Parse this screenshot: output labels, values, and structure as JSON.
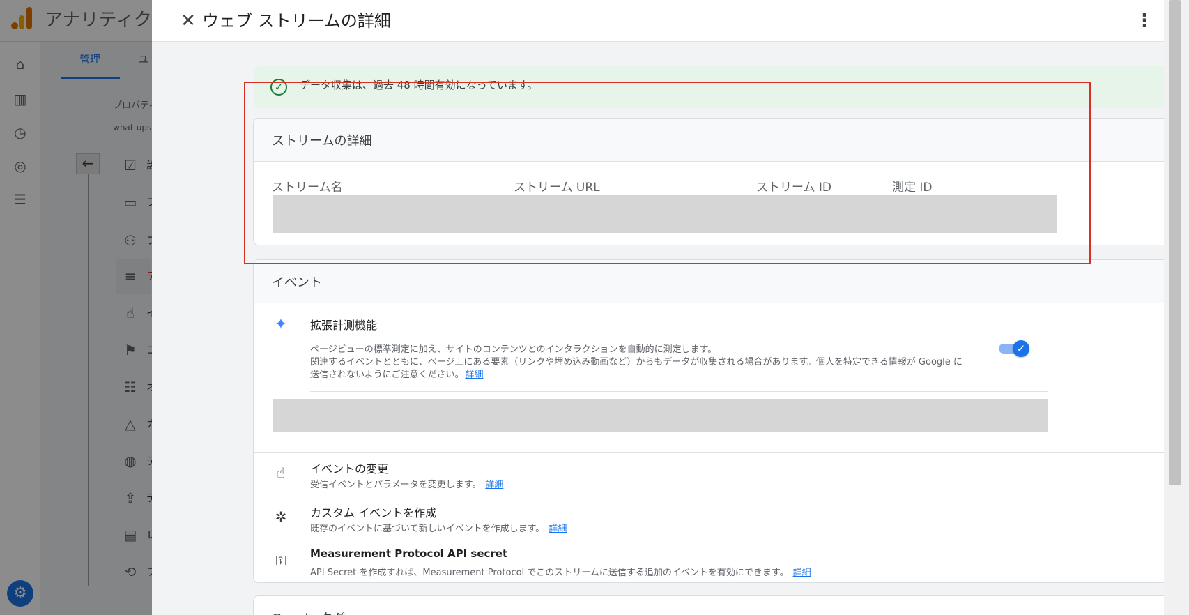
{
  "background_app": {
    "app_title": "アナリティクス",
    "tabs": {
      "manage": "管理",
      "user": "ユ"
    },
    "property_label": "プロパティ",
    "property_value": "what-ups-",
    "nav_letters": [
      "設",
      "フ",
      "フ",
      "デ",
      "イ",
      "コ",
      "オ",
      "カ",
      "デ",
      "デ",
      "レ",
      "フ"
    ]
  },
  "panel": {
    "title": "ウェブ ストリームの詳細",
    "banner_text": "データ収集は、過去 48 時間有効になっています。",
    "stream_details": {
      "heading": "ストリームの詳細",
      "columns": [
        "ストリーム名",
        "ストリーム URL",
        "ストリーム ID",
        "測定 ID"
      ]
    },
    "events": {
      "heading": "イベント",
      "enhanced": {
        "title": "拡張計測機能",
        "desc_line1": "ページビューの標準測定に加え、サイトのコンテンツとのインタラクションを自動的に測定します。",
        "desc_line2": "関連するイベントとともに、ページ上にある要素（リンクや埋め込み動画など）からもデータが収集される場合があります。個人を特定できる情報が Google に",
        "desc_line3": "送信されないようにご注意ください。",
        "link": "詳細",
        "enabled": true
      },
      "rows": [
        {
          "title": "イベントの変更",
          "desc": "受信イベントとパラメータを変更します。",
          "link": "詳細",
          "icon": "touch-icon"
        },
        {
          "title": "カスタム イベントを作成",
          "desc": "既存のイベントに基づいて新しいイベントを作成します。",
          "link": "詳細",
          "icon": "click-sparkle-icon"
        },
        {
          "title": "Measurement Protocol API secret",
          "desc": "API Secret を作成すれば、Measurement Protocol でこのストリームに送信する追加のイベントを有効にできます。",
          "link": "詳細",
          "icon": "key-icon"
        }
      ]
    },
    "next_card_heading": "Google タグ"
  },
  "colors": {
    "accent": "#1a73e8",
    "success": "#188038",
    "highlight": "#d93025"
  }
}
